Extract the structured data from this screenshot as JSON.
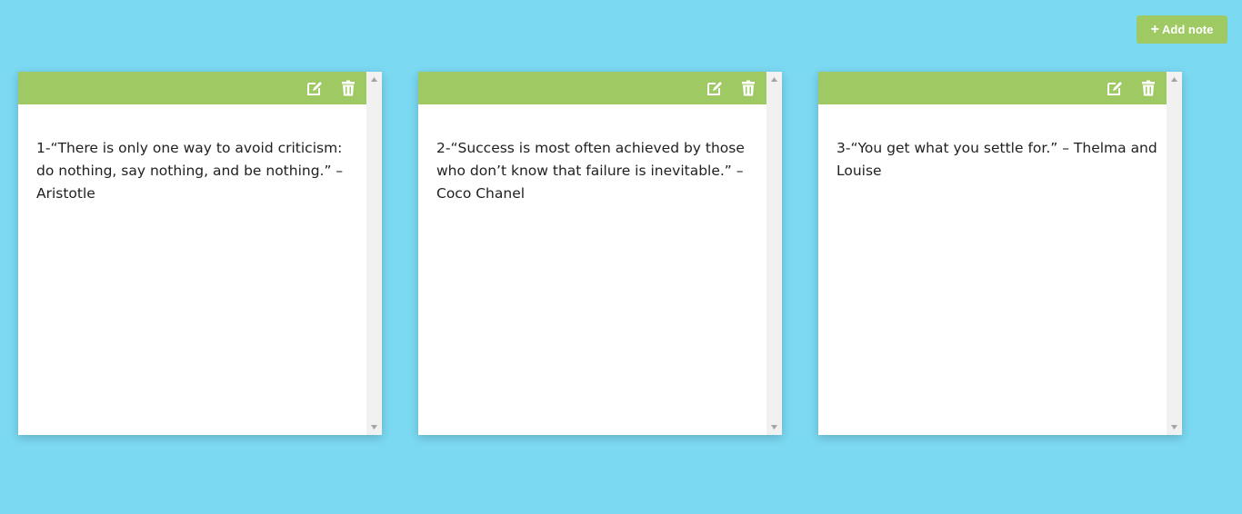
{
  "toolbar": {
    "add_note_label": "Add note",
    "accent_color": "#9ec963"
  },
  "colors": {
    "background": "#7bd9f2",
    "note_header": "#9ec963",
    "note_body": "#ffffff",
    "scrollbar_track": "#f1f1f1"
  },
  "notes": [
    {
      "text": "1-“There is only one way to avoid criticism: do nothing, say nothing, and be nothing.” – Aristotle",
      "edit_icon": "edit-icon",
      "delete_icon": "trash-icon"
    },
    {
      "text": "2-“Success is most often achieved by those who don’t know that failure is inevitable.” – Coco Chanel",
      "edit_icon": "edit-icon",
      "delete_icon": "trash-icon"
    },
    {
      "text": "3-“You get what you settle for.” – Thelma and Louise",
      "edit_icon": "edit-icon",
      "delete_icon": "trash-icon"
    }
  ]
}
